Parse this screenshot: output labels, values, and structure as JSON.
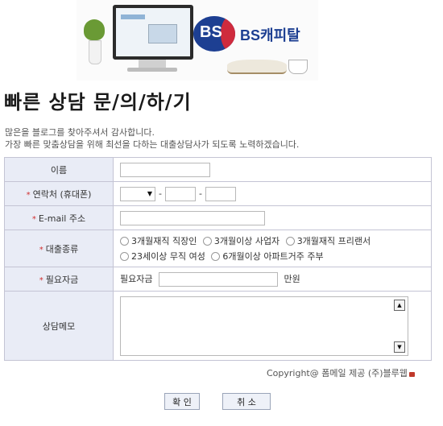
{
  "banner": {
    "logo_mark": "BS",
    "logo_text": "BS캐피탈"
  },
  "page": {
    "title": "빠른 상담 문/의/하/기",
    "intro_line1": "많은을 블로그를 찾아주셔서 감사합니다.",
    "intro_line2": "가장 빠른 맞춤상담을 위해 최선을 다하는 대출상담사가 되도록 노력하겠습니다."
  },
  "form": {
    "name_label": "이름",
    "required_mark": "*",
    "phone_label": "연락처 (휴대폰)",
    "phone_dash": "-",
    "email_label": "E-mail 주소",
    "loan_type_label": "대출종류",
    "loan_options": [
      "3개월재직 직장인",
      "3개월이상 사업자",
      "3개월재직 프리랜서",
      "23세이상 무직 여성",
      "6개월이상 아파트거주 주부"
    ],
    "amount_label": "필요자금",
    "amount_prefix": "필요자금",
    "amount_unit": "만원",
    "memo_label": "상담메모"
  },
  "footer": {
    "copyright": "Copyright@ 폼메일 제공 (주)블루웹"
  },
  "buttons": {
    "confirm": "확 인",
    "cancel": "취 소"
  },
  "icons": {
    "dropdown": "chevron-down-icon",
    "scroll_up": "scroll-up-icon",
    "scroll_down": "scroll-down-icon",
    "lock": "lock-icon"
  },
  "colors": {
    "brand_blue": "#1d3f92",
    "brand_red": "#cf2b3d",
    "label_bg": "#e9ecf6",
    "required": "#d03030"
  }
}
